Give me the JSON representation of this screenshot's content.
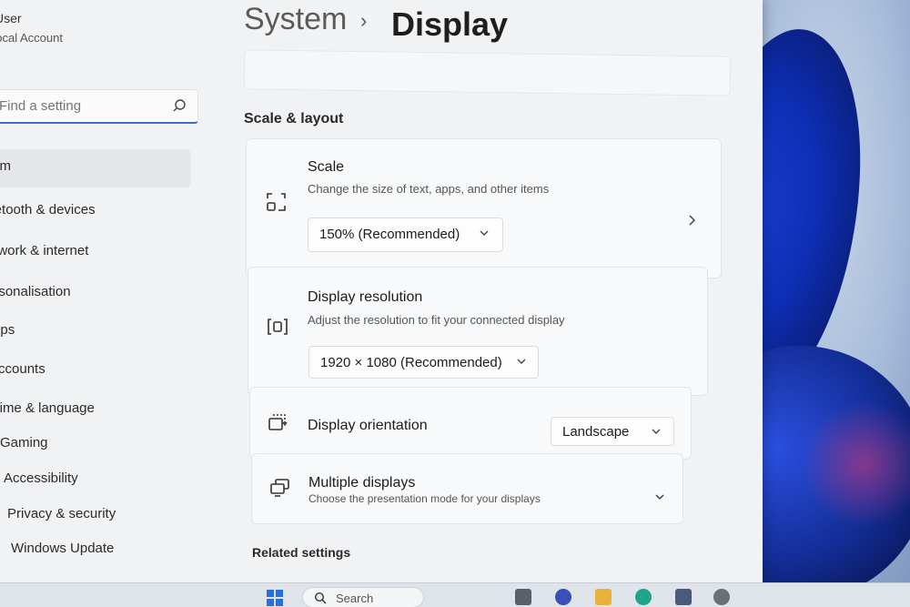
{
  "user": {
    "name": "User",
    "account_type": "Local Account"
  },
  "search": {
    "placeholder": "Find a setting"
  },
  "sidebar": {
    "items": [
      {
        "label": "System",
        "active": true
      },
      {
        "label": "Bluetooth & devices"
      },
      {
        "label": "Network & internet"
      },
      {
        "label": "Personalisation"
      },
      {
        "label": "Apps"
      },
      {
        "label": "Accounts"
      },
      {
        "label": "Time & language"
      },
      {
        "label": "Gaming"
      },
      {
        "label": "Accessibility"
      },
      {
        "label": "Privacy & security"
      },
      {
        "label": "Windows Update"
      }
    ]
  },
  "breadcrumb": {
    "parent": "System",
    "separator": "›",
    "current": "Display"
  },
  "section": {
    "title": "Scale & layout"
  },
  "scale": {
    "title": "Scale",
    "subtitle": "Change the size of text, apps, and other items",
    "value": "150% (Recommended)"
  },
  "resolution": {
    "title": "Display resolution",
    "subtitle": "Adjust the resolution to fit your connected display",
    "value": "1920 × 1080 (Recommended)"
  },
  "orientation": {
    "title": "Display orientation",
    "value": "Landscape"
  },
  "multiple": {
    "title": "Multiple displays",
    "subtitle": "Choose the presentation mode for your displays"
  },
  "related": {
    "title": "Related settings"
  },
  "taskbar": {
    "search_label": "Search"
  },
  "colors": {
    "accent": "#3b6fc7",
    "wallpaper_blue": "#1a3fd1"
  }
}
